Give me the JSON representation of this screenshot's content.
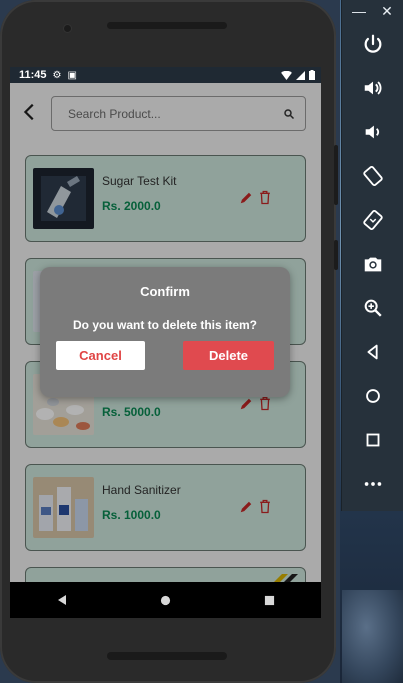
{
  "status_bar": {
    "time": "11:45"
  },
  "search": {
    "placeholder": "Search Product..."
  },
  "products": [
    {
      "name": "Sugar Test Kit",
      "price": "Rs. 2000.0"
    },
    {
      "name": "",
      "price": ""
    },
    {
      "name": "",
      "price": "Rs. 5000.0"
    },
    {
      "name": "Hand Sanitizer",
      "price": "Rs. 1000.0"
    }
  ],
  "dialog": {
    "title": "Confirm",
    "message": "Do you want to delete this item?",
    "cancel_label": "Cancel",
    "delete_label": "Delete"
  },
  "emulator_toolbar": {
    "minimize_label": "—",
    "close_label": "✕",
    "buttons": [
      "power-icon",
      "volume-up-icon",
      "volume-down-icon",
      "rotate-left-icon",
      "rotate-right-icon",
      "camera-icon",
      "zoom-icon",
      "back-icon",
      "home-icon",
      "overview-icon",
      "more-icon"
    ]
  },
  "colors": {
    "card_bg": "#cfe9df",
    "price": "#0a8a53",
    "delete_button": "#e04a4f",
    "cancel_text": "#e04545",
    "dialog_bg": "#7b7b7b"
  }
}
